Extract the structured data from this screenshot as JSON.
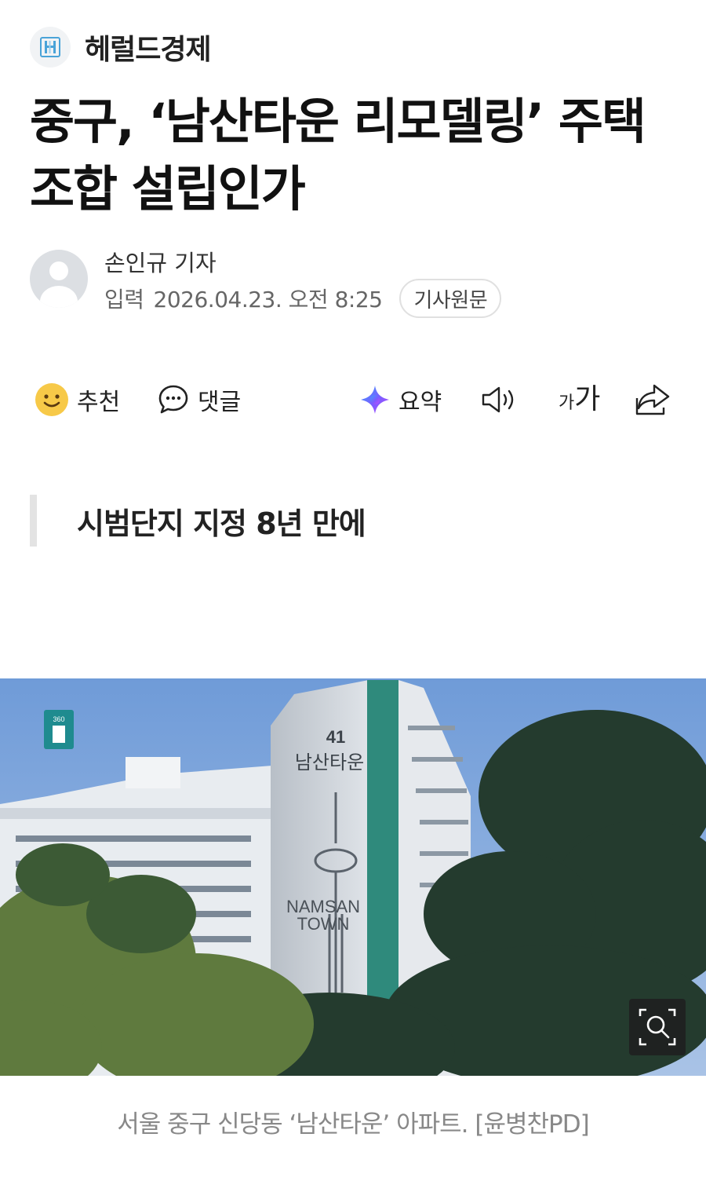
{
  "press": {
    "name": "헤럴드경제"
  },
  "article": {
    "title": "중구, ‘남산타운 리모델링’ 주택조합 설립인가",
    "reporter": "손인규 기자",
    "date_label": "입력",
    "date_value": "2026.04.23. 오전 8:25",
    "original_button": "기사원문",
    "subheading": "시범단지 지정 8년 만에",
    "photo_text": {
      "number": "41",
      "name": "남산타운",
      "en_line1": "NAMSAN",
      "en_line2": "TOWN",
      "badge": "360"
    },
    "caption": "서울 중구 신당동 ‘남산타운’ 아파트. [윤병찬PD]"
  },
  "actions": {
    "recommend": "추천",
    "comment": "댓글",
    "summary": "요약",
    "font_small": "가",
    "font_large": "가"
  },
  "colors": {
    "accent_logo": "#4aa3d8",
    "emoji_yellow": "#f7c948",
    "summary_purple": "#7b5cff",
    "summary_blue": "#3aa0ff",
    "badge_teal": "#1f8b8f",
    "sky": "#7fa6dc"
  },
  "icons": [
    "press-logo-icon",
    "smile-icon",
    "comment-icon",
    "sparkle-icon",
    "speaker-icon",
    "font-size-icon",
    "share-icon",
    "zoom-icon",
    "badge-360-icon"
  ]
}
